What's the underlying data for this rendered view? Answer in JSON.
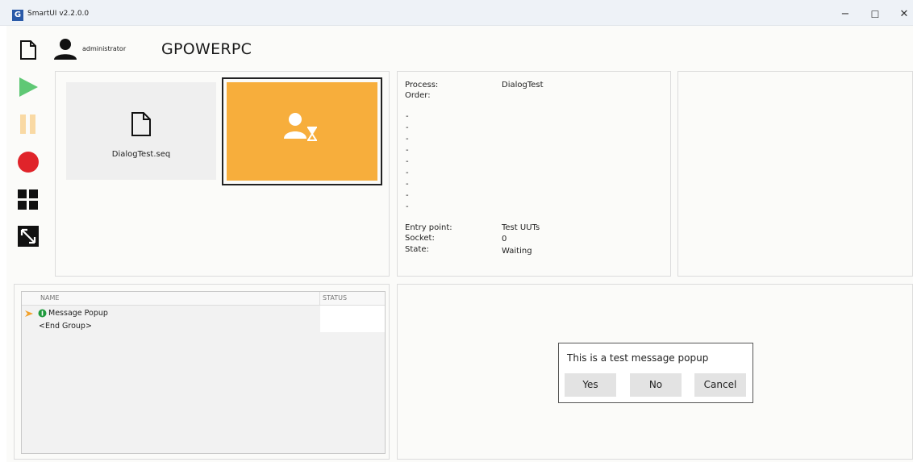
{
  "window": {
    "title": "SmartUI v2.2.0.0",
    "app_icon_letter": "G",
    "minimize_glyph": "−",
    "maximize_glyph": "☐",
    "close_glyph": "✕"
  },
  "header": {
    "username": "administrator",
    "machine_name": "GPOWERPC"
  },
  "toolbar": {
    "icons": [
      "new-file-icon",
      "play-icon",
      "pause-icon",
      "record-icon",
      "grid-icon",
      "resize-icon"
    ],
    "colors": {
      "play": "#5fc875",
      "pause": "#f9d9a4",
      "record": "#e0242a",
      "dark": "#111111"
    }
  },
  "sequence_panel": {
    "sequence_file": "DialogTest.seq",
    "uut_card_color": "#f7ae3c"
  },
  "info_panel": {
    "process_label": "Process:",
    "process_value": "DialogTest",
    "order_label": "Order:",
    "dashes": [
      "-",
      "-",
      "-",
      "-",
      "-",
      "-",
      "-",
      "-",
      "-"
    ],
    "entry_point_label": "Entry point:",
    "entry_point_value": "Test UUTs",
    "socket_label": "Socket:",
    "socket_value": "0",
    "state_label": "State:",
    "state_value": "Waiting"
  },
  "steps_panel": {
    "columns": {
      "name": "NAME",
      "status": "STATUS"
    },
    "rows": [
      {
        "name": "Message Popup",
        "status": ""
      },
      {
        "name": "<End Group>",
        "status": ""
      }
    ]
  },
  "popup": {
    "message": "This is a test message popup",
    "buttons": {
      "yes": "Yes",
      "no": "No",
      "cancel": "Cancel"
    }
  }
}
